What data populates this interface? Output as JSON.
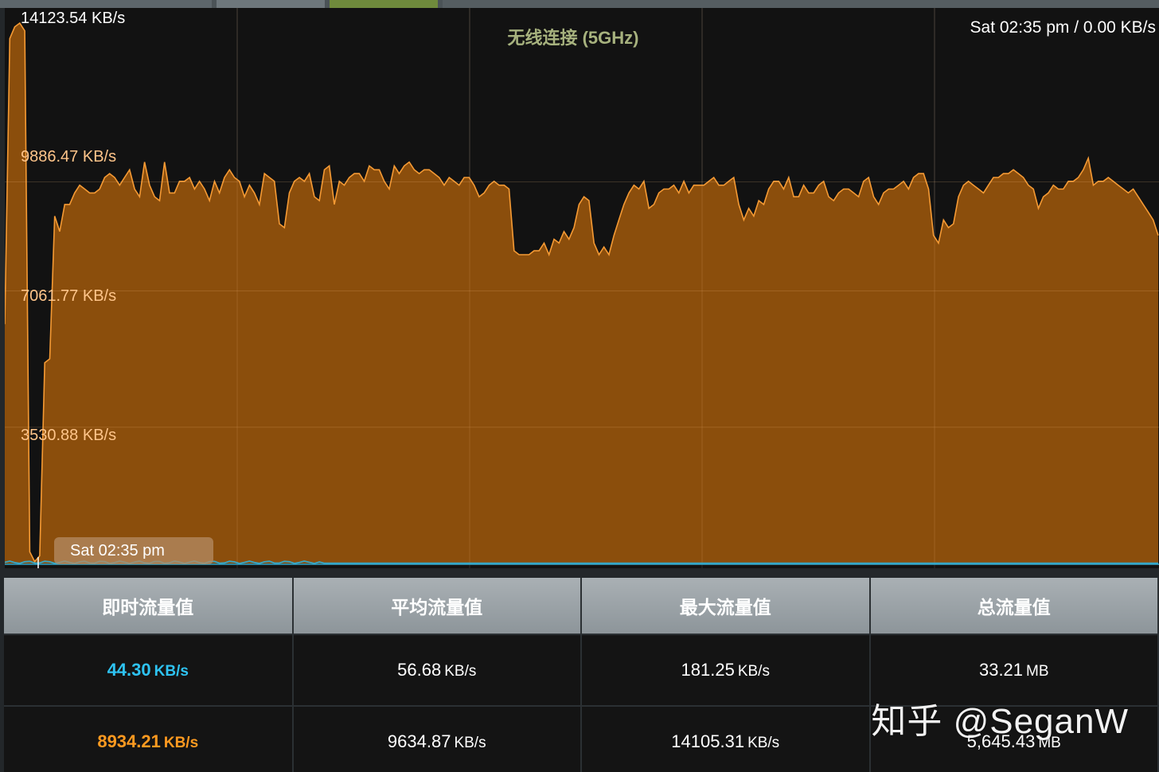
{
  "tabs": [
    "",
    "",
    "",
    ""
  ],
  "chart": {
    "title": "无线连接 (5GHz)",
    "status": "Sat 02:35 pm / 0.00 KB/s",
    "hover_time": "Sat 02:35 pm",
    "y_labels": [
      "14123.54 KB/s",
      "9886.47 KB/s",
      "7061.77 KB/s",
      "3530.88 KB/s"
    ],
    "fill_color": "#8b4e0c",
    "line_color": "#f59a34",
    "upload_color": "#36a8c8"
  },
  "chart_data": {
    "type": "area",
    "title": "无线连接 (5GHz)",
    "xlabel": "",
    "ylabel": "",
    "ylim": [
      0,
      14123.54
    ],
    "yticks": [
      3530.88,
      7061.77,
      9886.47,
      14123.54
    ],
    "grid": true,
    "series": [
      {
        "name": "",
        "values": [
          6200,
          13600,
          13900,
          14000,
          13800,
          300,
          50,
          200,
          5200,
          5300,
          9000,
          8600,
          9300,
          9300,
          9600,
          9800,
          9700,
          9600,
          9600,
          9700,
          10000,
          10100,
          10000,
          9800,
          10000,
          10200,
          9700,
          9500,
          10400,
          9800,
          9500,
          9400,
          10400,
          9600,
          9600,
          9900,
          9900,
          10000,
          9700,
          9900,
          9700,
          9400,
          9900,
          9600,
          10000,
          10200,
          10000,
          9900,
          9500,
          9800,
          9600,
          9300,
          10100,
          10000,
          9900,
          8800,
          8700,
          9600,
          9900,
          10000,
          9900,
          10100,
          9500,
          9400,
          10200,
          10300,
          9300,
          9900,
          9800,
          10000,
          10100,
          10100,
          9900,
          10300,
          10200,
          10200,
          9900,
          9700,
          10300,
          10100,
          10300,
          10400,
          10200,
          10100,
          10200,
          10200,
          10100,
          10000,
          9800,
          10000,
          9900,
          9800,
          10000,
          10000,
          9800,
          9500,
          9600,
          9800,
          9900,
          9800,
          9800,
          9700,
          8100,
          8000,
          8000,
          8000,
          8100,
          8100,
          8300,
          8000,
          8400,
          8300,
          8600,
          8400,
          8700,
          9300,
          9500,
          9400,
          8300,
          8000,
          8200,
          8000,
          8500,
          8900,
          9300,
          9600,
          9800,
          9700,
          9900,
          9200,
          9300,
          9600,
          9700,
          9700,
          9800,
          9600,
          9900,
          9600,
          9800,
          9800,
          9800,
          9900,
          10000,
          9800,
          9800,
          9900,
          10000,
          9300,
          8900,
          9200,
          9000,
          9400,
          9300,
          9700,
          9900,
          9900,
          9700,
          10000,
          9500,
          9500,
          9800,
          9600,
          9600,
          9800,
          9900,
          9500,
          9400,
          9600,
          9700,
          9700,
          9600,
          9500,
          9900,
          10000,
          9500,
          9300,
          9600,
          9700,
          9700,
          9800,
          9900,
          9700,
          10000,
          10100,
          10100,
          9700,
          8500,
          8300,
          8900,
          8700,
          8800,
          9500,
          9800,
          9900,
          9800,
          9700,
          9600,
          9800,
          10000,
          10000,
          10100,
          10100,
          10200,
          10100,
          10000,
          9800,
          9700,
          9200,
          9500,
          9600,
          9800,
          9700,
          9700,
          9900,
          9900,
          10000,
          10200,
          10500,
          9800,
          9900,
          9900,
          10000,
          9900,
          9800,
          9700,
          9600,
          9700,
          9500,
          9300,
          9100,
          8900,
          8500
        ]
      }
    ]
  },
  "stats": {
    "headers": [
      "即时流量值",
      "平均流量值",
      "最大流量值",
      "总流量值"
    ],
    "row1": {
      "current": "44.30",
      "current_unit": "KB/s",
      "average": "56.68",
      "average_unit": "KB/s",
      "max": "181.25",
      "max_unit": "KB/s",
      "total": "33.21",
      "total_unit": "MB"
    },
    "row2": {
      "current": "8934.21",
      "current_unit": "KB/s",
      "average": "9634.87",
      "average_unit": "KB/s",
      "max": "14105.31",
      "max_unit": "KB/s",
      "total": "5,645.43",
      "total_unit": "MB"
    },
    "colors": {
      "upload": "#2ec3f2",
      "download": "#ff9a20"
    }
  },
  "watermark": "知乎 @SeganW"
}
